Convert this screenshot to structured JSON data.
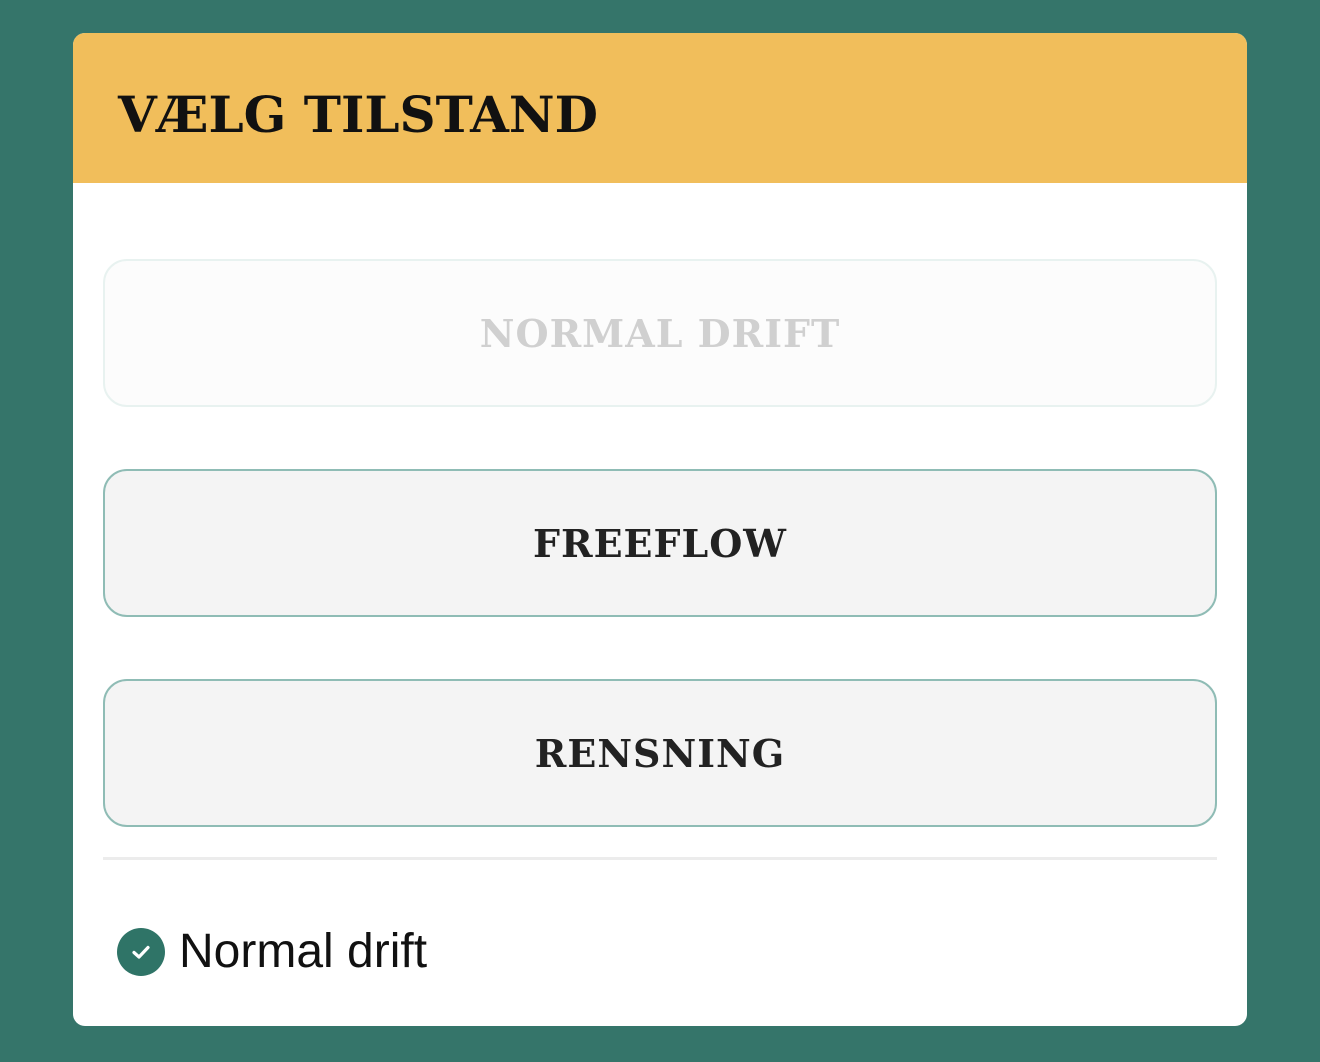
{
  "panel": {
    "title": "VÆLG TILSTAND"
  },
  "modes": [
    {
      "label": "NORMAL DRIFT",
      "state": "disabled"
    },
    {
      "label": "FREEFLOW",
      "state": "enabled"
    },
    {
      "label": "RENSNING",
      "state": "enabled"
    }
  ],
  "status": {
    "icon": "check-circle-icon",
    "text": "Normal drift"
  },
  "colors": {
    "background": "#35756a",
    "header": "#f1be5b",
    "accent": "#2f7467",
    "button_border": "#8fbcb5"
  }
}
